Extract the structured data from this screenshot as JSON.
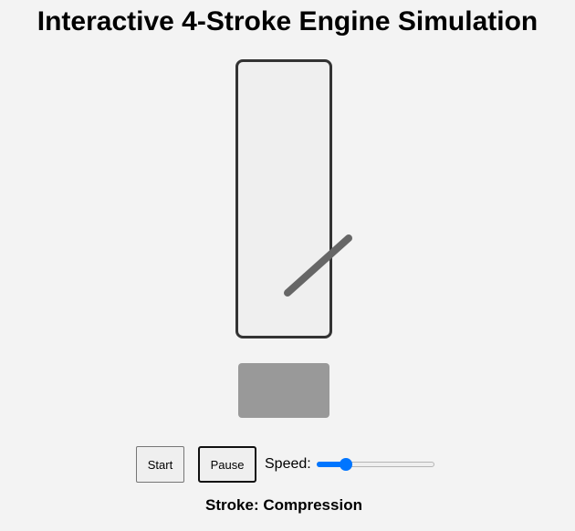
{
  "title": "Interactive 4-Stroke Engine Simulation",
  "controls": {
    "start_label": "Start",
    "pause_label": "Pause",
    "speed_label": "Speed:",
    "speed_value": 0.25
  },
  "status": {
    "prefix": "Stroke: ",
    "stroke": "Compression"
  },
  "colors": {
    "background": "#f3f3f3",
    "cylinder_fill": "#efefef",
    "cylinder_border": "#333333",
    "rod": "#666666",
    "piston": "#999999",
    "slider_accent": "#0075ff"
  }
}
